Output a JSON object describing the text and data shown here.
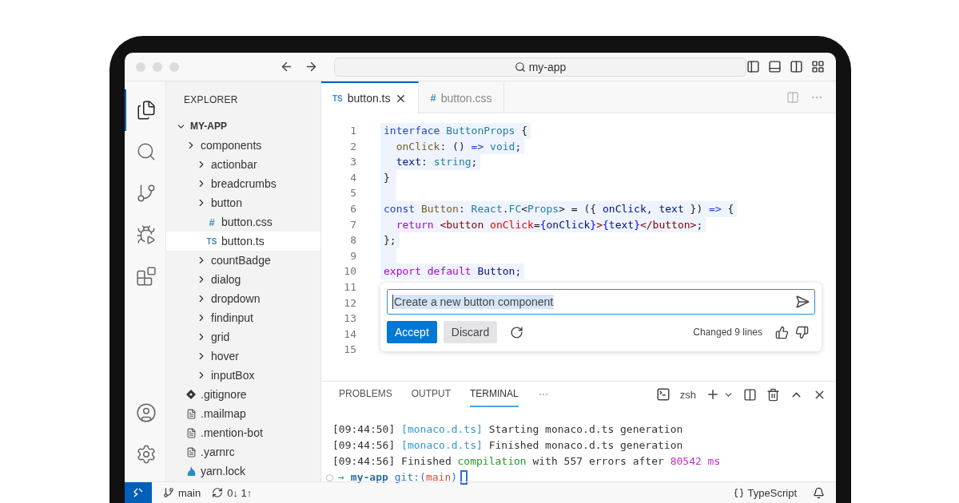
{
  "window": {
    "title": "my-app"
  },
  "activity_bar": [
    {
      "selected": true
    },
    {
      "selected": false
    },
    {
      "selected": false
    },
    {
      "selected": false
    },
    {
      "selected": false
    }
  ],
  "sidebar": {
    "title": "EXPLORER",
    "tree": [
      {
        "label": "MY-APP",
        "kind": "root",
        "selected": false,
        "children": [
          {
            "label": "components",
            "kind": "folder",
            "selected": false,
            "children": [
              {
                "label": "actionbar",
                "kind": "folder",
                "selected": false
              },
              {
                "label": "breadcrumbs",
                "kind": "folder",
                "selected": false
              },
              {
                "label": "button",
                "kind": "folder",
                "selected": false,
                "children": [
                  {
                    "label": "button.css",
                    "kind": "css-file",
                    "badge": "#",
                    "selected": false
                  },
                  {
                    "label": "button.ts",
                    "kind": "ts-file",
                    "badge": "TS",
                    "selected": true
                  }
                ]
              },
              {
                "label": "countBadge",
                "kind": "folder",
                "selected": false
              },
              {
                "label": "dialog",
                "kind": "folder",
                "selected": false
              },
              {
                "label": "dropdown",
                "kind": "folder",
                "selected": false
              },
              {
                "label": "findinput",
                "kind": "folder",
                "selected": false
              },
              {
                "label": "grid",
                "kind": "folder",
                "selected": false
              },
              {
                "label": "hover",
                "kind": "folder",
                "selected": false
              },
              {
                "label": "inputBox",
                "kind": "folder",
                "selected": false
              }
            ]
          },
          {
            "label": ".gitignore",
            "kind": "git-file",
            "selected": false
          },
          {
            "label": ".mailmap",
            "kind": "text-file",
            "selected": false
          },
          {
            "label": ".mention-bot",
            "kind": "text-file",
            "selected": false
          },
          {
            "label": ".yarnrc",
            "kind": "text-file",
            "selected": false
          },
          {
            "label": "yarn.lock",
            "kind": "yarn-file",
            "selected": false
          }
        ]
      }
    ]
  },
  "editor_tabs": [
    {
      "label": "button.ts",
      "badge": "TS",
      "kind": "ts-file",
      "selected": true
    },
    {
      "label": "button.css",
      "badge": "#",
      "kind": "css-file",
      "selected": false
    }
  ],
  "code": {
    "line_numbers": [
      "1",
      "2",
      "3",
      "4",
      "5",
      "6",
      "7",
      "8",
      "9",
      "10",
      "11",
      "12",
      "13",
      "14",
      "15"
    ],
    "lines": [
      {
        "highlighted": true,
        "tokens": [
          {
            "t": "interface ",
            "kind": "keyword"
          },
          {
            "t": "ButtonProps",
            "kind": "type"
          },
          {
            "t": " {",
            "kind": "punct"
          }
        ]
      },
      {
        "highlighted": true,
        "tokens": [
          {
            "t": "  onClick",
            "kind": "func"
          },
          {
            "t": ": () ",
            "kind": "punct"
          },
          {
            "t": "=>",
            "kind": "keyword"
          },
          {
            "t": " void",
            "kind": "type"
          },
          {
            "t": ";",
            "kind": "punct"
          }
        ]
      },
      {
        "highlighted": true,
        "tokens": [
          {
            "t": "  text",
            "kind": "var"
          },
          {
            "t": ": ",
            "kind": "punct"
          },
          {
            "t": "string",
            "kind": "type"
          },
          {
            "t": ";",
            "kind": "punct"
          }
        ]
      },
      {
        "highlighted": true,
        "tokens": [
          {
            "t": "}",
            "kind": "punct"
          }
        ]
      },
      {
        "highlighted": true
      },
      {
        "highlighted": true,
        "tokens": [
          {
            "t": "const ",
            "kind": "keyword"
          },
          {
            "t": "Button",
            "kind": "func"
          },
          {
            "t": ": ",
            "kind": "punct"
          },
          {
            "t": "React",
            "kind": "type"
          },
          {
            "t": ".",
            "kind": "punct"
          },
          {
            "t": "FC",
            "kind": "type"
          },
          {
            "t": "<",
            "kind": "punct"
          },
          {
            "t": "Props",
            "kind": "type"
          },
          {
            "t": "> = ({ ",
            "kind": "punct"
          },
          {
            "t": "onClick",
            "kind": "var"
          },
          {
            "t": ", ",
            "kind": "punct"
          },
          {
            "t": "text",
            "kind": "var"
          },
          {
            "t": " }) ",
            "kind": "punct"
          },
          {
            "t": "=>",
            "kind": "keyword"
          },
          {
            "t": " {",
            "kind": "punct"
          }
        ]
      },
      {
        "highlighted": true,
        "tokens": [
          {
            "t": "  return ",
            "kind": "control"
          },
          {
            "t": "<button ",
            "kind": "tag"
          },
          {
            "t": "onClick",
            "kind": "attr"
          },
          {
            "t": "=",
            "kind": "punct"
          },
          {
            "t": "{",
            "kind": "brace"
          },
          {
            "t": "onClick",
            "kind": "var"
          },
          {
            "t": "}",
            "kind": "brace"
          },
          {
            "t": ">",
            "kind": "tag"
          },
          {
            "t": "{",
            "kind": "brace"
          },
          {
            "t": "text",
            "kind": "var"
          },
          {
            "t": "}",
            "kind": "brace"
          },
          {
            "t": "</button>",
            "kind": "tag"
          },
          {
            "t": ";",
            "kind": "punct"
          }
        ]
      },
      {
        "highlighted": true,
        "tokens": [
          {
            "t": "};",
            "kind": "punct"
          }
        ]
      },
      {
        "highlighted": true
      },
      {
        "highlighted": true,
        "tokens": [
          {
            "t": "export default ",
            "kind": "control"
          },
          {
            "t": "Button",
            "kind": "var"
          },
          {
            "t": ";",
            "kind": "punct"
          }
        ]
      }
    ]
  },
  "inline_chat": {
    "value": "Create a new button component",
    "buttons": [
      {
        "label": "Accept",
        "kind": "primary"
      },
      {
        "label": "Discard",
        "kind": "secondary"
      }
    ],
    "status": "Changed 9 lines"
  },
  "panel": {
    "tabs": [
      {
        "label": "PROBLEMS",
        "selected": false
      },
      {
        "label": "OUTPUT",
        "selected": false
      },
      {
        "label": "TERMINAL",
        "selected": true
      }
    ],
    "shell": "zsh",
    "terminal_lines": [
      [
        {
          "t": "[09:44:50] ",
          "kind": "plain"
        },
        {
          "t": "[monaco.d.ts]",
          "kind": "cyan"
        },
        {
          "t": " Starting monaco.d.ts generation",
          "kind": "plain"
        }
      ],
      [
        {
          "t": "[09:44:56] ",
          "kind": "plain"
        },
        {
          "t": "[monaco.d.ts]",
          "kind": "cyan"
        },
        {
          "t": " Finished monaco.d.ts generation",
          "kind": "plain"
        }
      ],
      [
        {
          "t": "[09:44:56] Finished ",
          "kind": "plain"
        },
        {
          "t": "compilation",
          "kind": "green"
        },
        {
          "t": " with 557 errors after ",
          "kind": "plain"
        },
        {
          "t": "80542 ms",
          "kind": "magenta"
        }
      ]
    ],
    "prompt": [
      {
        "t": "→",
        "kind": "arrow"
      },
      {
        "t": "my-app",
        "kind": "dir"
      },
      {
        "t": "git:(",
        "kind": "git"
      },
      {
        "t": "main",
        "kind": "branch"
      },
      {
        "t": ")",
        "kind": "git"
      }
    ]
  },
  "status_bar": {
    "branch": "main",
    "sync": "0↓ 1↑",
    "language": "TypeScript"
  }
}
